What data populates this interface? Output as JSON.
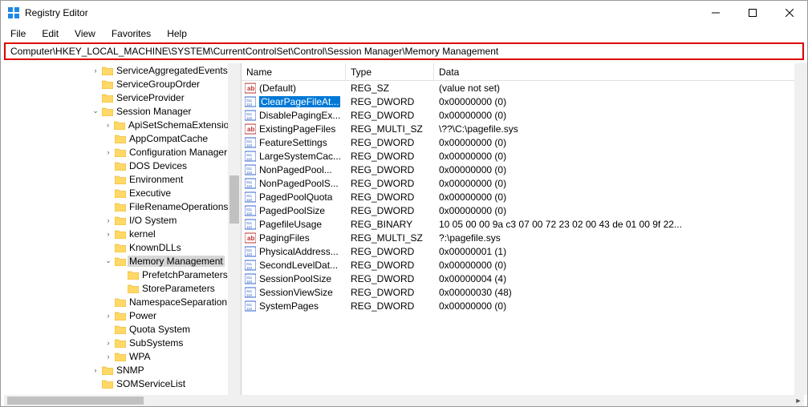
{
  "window": {
    "title": "Registry Editor"
  },
  "menu": {
    "file": "File",
    "edit": "Edit",
    "view": "View",
    "favorites": "Favorites",
    "help": "Help"
  },
  "address": "Computer\\HKEY_LOCAL_MACHINE\\SYSTEM\\CurrentControlSet\\Control\\Session Manager\\Memory Management",
  "tree": [
    {
      "indent": 3,
      "exp": ">",
      "label": "ServiceAggregatedEvents"
    },
    {
      "indent": 3,
      "exp": "",
      "label": "ServiceGroupOrder"
    },
    {
      "indent": 3,
      "exp": "",
      "label": "ServiceProvider"
    },
    {
      "indent": 3,
      "exp": "v",
      "label": "Session Manager"
    },
    {
      "indent": 4,
      "exp": ">",
      "label": "ApiSetSchemaExtensions"
    },
    {
      "indent": 4,
      "exp": "",
      "label": "AppCompatCache"
    },
    {
      "indent": 4,
      "exp": ">",
      "label": "Configuration Manager"
    },
    {
      "indent": 4,
      "exp": "",
      "label": "DOS Devices"
    },
    {
      "indent": 4,
      "exp": "",
      "label": "Environment"
    },
    {
      "indent": 4,
      "exp": "",
      "label": "Executive"
    },
    {
      "indent": 4,
      "exp": "",
      "label": "FileRenameOperations"
    },
    {
      "indent": 4,
      "exp": ">",
      "label": "I/O System"
    },
    {
      "indent": 4,
      "exp": ">",
      "label": "kernel"
    },
    {
      "indent": 4,
      "exp": "",
      "label": "KnownDLLs"
    },
    {
      "indent": 4,
      "exp": "v",
      "label": "Memory Management",
      "selected": true
    },
    {
      "indent": 5,
      "exp": "",
      "label": "PrefetchParameters"
    },
    {
      "indent": 5,
      "exp": "",
      "label": "StoreParameters"
    },
    {
      "indent": 4,
      "exp": "",
      "label": "NamespaceSeparation"
    },
    {
      "indent": 4,
      "exp": ">",
      "label": "Power"
    },
    {
      "indent": 4,
      "exp": "",
      "label": "Quota System"
    },
    {
      "indent": 4,
      "exp": ">",
      "label": "SubSystems"
    },
    {
      "indent": 4,
      "exp": ">",
      "label": "WPA"
    },
    {
      "indent": 3,
      "exp": ">",
      "label": "SNMP"
    },
    {
      "indent": 3,
      "exp": "",
      "label": "SOMServiceList"
    }
  ],
  "columns": {
    "name": "Name",
    "type": "Type",
    "data": "Data"
  },
  "values": [
    {
      "icon": "sz",
      "name": "(Default)",
      "type": "REG_SZ",
      "data": "(value not set)"
    },
    {
      "icon": "dw",
      "name": "ClearPageFileAt...",
      "type": "REG_DWORD",
      "data": "0x00000000 (0)",
      "selected": true
    },
    {
      "icon": "dw",
      "name": "DisablePagingEx...",
      "type": "REG_DWORD",
      "data": "0x00000000 (0)"
    },
    {
      "icon": "sz",
      "name": "ExistingPageFiles",
      "type": "REG_MULTI_SZ",
      "data": "\\??\\C:\\pagefile.sys"
    },
    {
      "icon": "dw",
      "name": "FeatureSettings",
      "type": "REG_DWORD",
      "data": "0x00000000 (0)"
    },
    {
      "icon": "dw",
      "name": "LargeSystemCac...",
      "type": "REG_DWORD",
      "data": "0x00000000 (0)"
    },
    {
      "icon": "dw",
      "name": "NonPagedPool...",
      "type": "REG_DWORD",
      "data": "0x00000000 (0)"
    },
    {
      "icon": "dw",
      "name": "NonPagedPoolS...",
      "type": "REG_DWORD",
      "data": "0x00000000 (0)"
    },
    {
      "icon": "dw",
      "name": "PagedPoolQuota",
      "type": "REG_DWORD",
      "data": "0x00000000 (0)"
    },
    {
      "icon": "dw",
      "name": "PagedPoolSize",
      "type": "REG_DWORD",
      "data": "0x00000000 (0)"
    },
    {
      "icon": "dw",
      "name": "PagefileUsage",
      "type": "REG_BINARY",
      "data": "10 05 00 00 9a c3 07 00 72 23 02 00 43 de 01 00 9f 22..."
    },
    {
      "icon": "sz",
      "name": "PagingFiles",
      "type": "REG_MULTI_SZ",
      "data": "?:\\pagefile.sys"
    },
    {
      "icon": "dw",
      "name": "PhysicalAddress...",
      "type": "REG_DWORD",
      "data": "0x00000001 (1)"
    },
    {
      "icon": "dw",
      "name": "SecondLevelDat...",
      "type": "REG_DWORD",
      "data": "0x00000000 (0)"
    },
    {
      "icon": "dw",
      "name": "SessionPoolSize",
      "type": "REG_DWORD",
      "data": "0x00000004 (4)"
    },
    {
      "icon": "dw",
      "name": "SessionViewSize",
      "type": "REG_DWORD",
      "data": "0x00000030 (48)"
    },
    {
      "icon": "dw",
      "name": "SystemPages",
      "type": "REG_DWORD",
      "data": "0x00000000 (0)"
    }
  ]
}
